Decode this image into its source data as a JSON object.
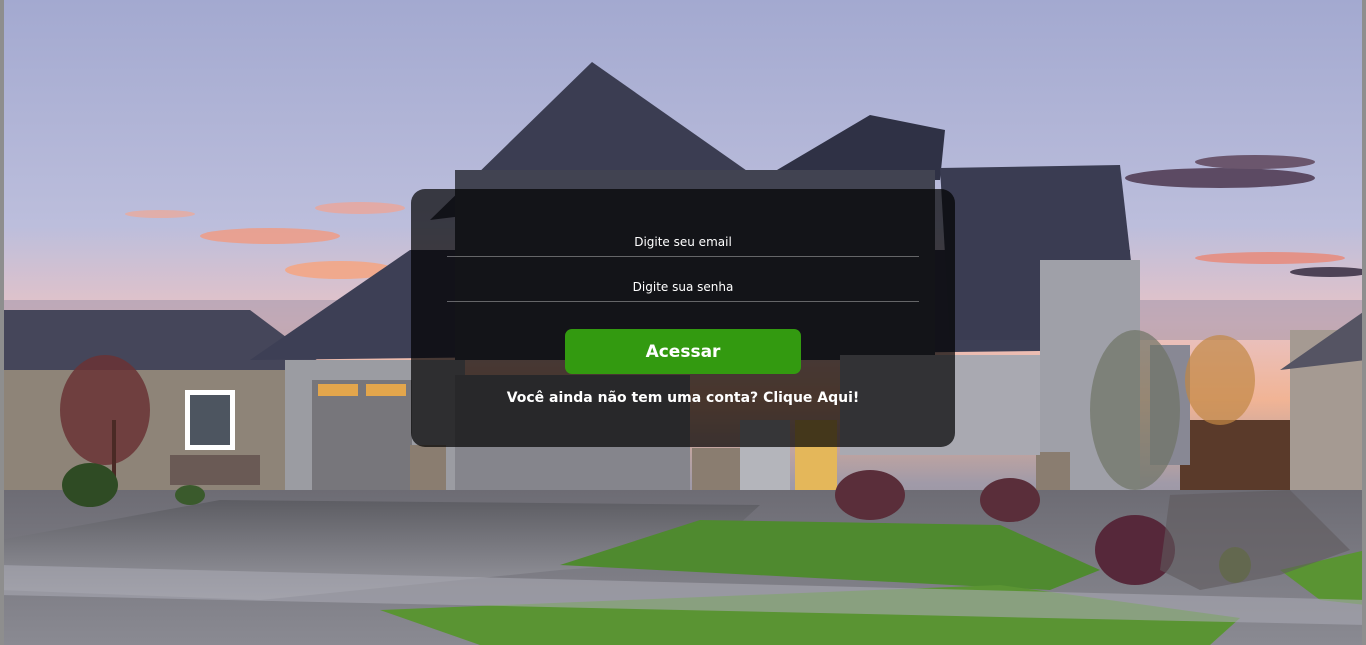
{
  "login": {
    "email_placeholder": "Digite seu email",
    "password_placeholder": "Digite sua senha",
    "submit_label": "Acessar",
    "signup_prompt": "Você ainda não tem uma conta?",
    "signup_link": "Clique Aqui!"
  },
  "colors": {
    "accent": "#339a10",
    "card_background": "rgba(0,0,0,0.70)",
    "text": "#ffffff"
  }
}
